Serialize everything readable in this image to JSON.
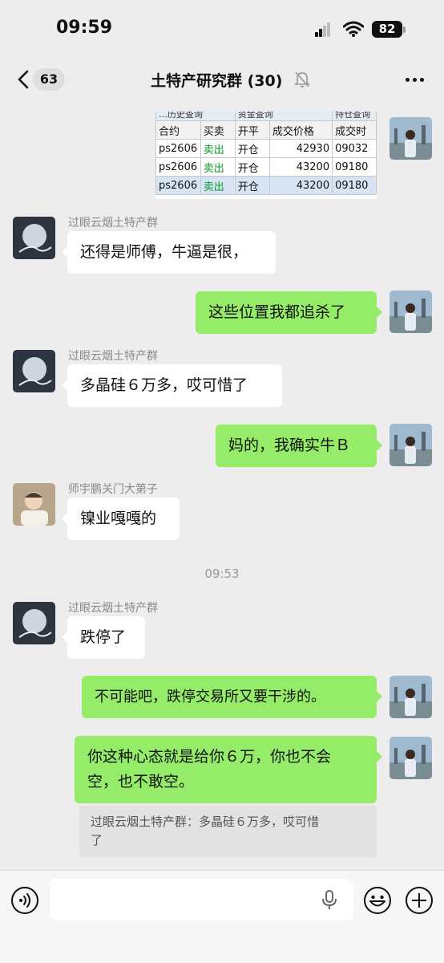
{
  "status_bar": {
    "time": "09:59",
    "battery": "82"
  },
  "nav": {
    "unread_count": "63",
    "title": "土特产研究群 (30)"
  },
  "screenshot_table": {
    "tabs": [
      "…历史查询",
      "资金查询",
      "持仓查询"
    ],
    "headers": [
      "合约",
      "买卖",
      "开平",
      "成交价格",
      "成交时"
    ],
    "rows": [
      [
        "ps2606",
        "卖出",
        "开仓",
        "42930",
        "09032"
      ],
      [
        "ps2606",
        "卖出",
        "开仓",
        "43200",
        "09180"
      ],
      [
        "ps2606",
        "卖出",
        "开仓",
        "43200",
        "09180"
      ]
    ]
  },
  "messages": [
    {
      "sender": "过眼云烟土特产群",
      "text": "还得是师傅，牛逼是很，"
    },
    {
      "sender": "me",
      "text": "这些位置我都追杀了"
    },
    {
      "sender": "过眼云烟土特产群",
      "text": "多晶硅６万多，哎可惜了"
    },
    {
      "sender": "me",
      "text": "妈的，我确实牛Ｂ"
    },
    {
      "sender": "师宇鹏关门大第子",
      "text": "镍业嘎嘎的"
    },
    {
      "sender": "过眼云烟土特产群",
      "text": "跌停了"
    },
    {
      "sender": "me",
      "text": "不可能吧，跌停交易所又要干涉的。"
    },
    {
      "sender": "me",
      "text_line1": "你这种心态就是给你６万，你也不会",
      "text_line2": "空，也不敢空。"
    }
  ],
  "timestamp": "09:53",
  "quote": {
    "line1": "过眼云烟土特产群：多晶硅６万多，哎可惜",
    "line2": "了"
  },
  "icons": {
    "back": "chevron-left-icon",
    "mute": "bell-off-icon",
    "more": "more-dots-icon",
    "voice": "voice-icon",
    "mic": "microphone-icon",
    "emoji": "emoji-icon",
    "plus": "plus-icon"
  },
  "colors": {
    "my_bubble": "#95ec69",
    "other_bubble": "#ffffff",
    "background": "#ededed"
  }
}
